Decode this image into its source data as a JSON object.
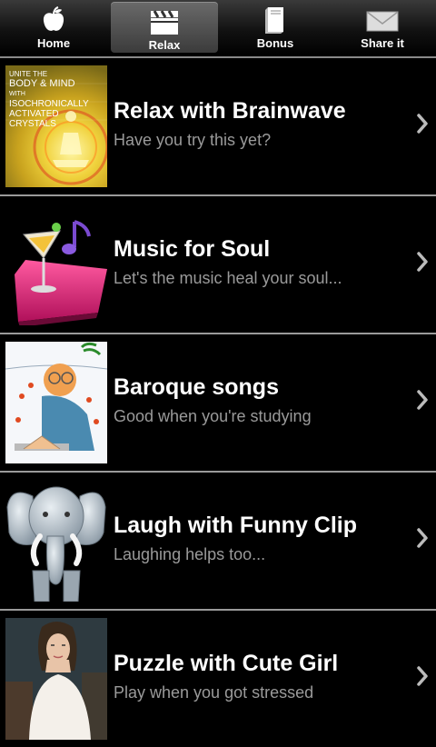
{
  "tabs": [
    {
      "label": "Home",
      "icon": "apple-icon"
    },
    {
      "label": "Relax",
      "icon": "clapperboard-icon"
    },
    {
      "label": "Bonus",
      "icon": "book-icon"
    },
    {
      "label": "Share it",
      "icon": "envelope-icon"
    }
  ],
  "active_tab": "Relax",
  "items": [
    {
      "title": "Relax with Brainwave",
      "subtitle": "Have you try this yet?",
      "thumb_text": [
        "UNITE THE",
        "BODY & MIND",
        "WITH",
        "ISOCHRONICALLY",
        "ACTIVATED",
        "CRYSTALS"
      ],
      "thumb_icon": "meditation-cover-icon"
    },
    {
      "title": "Music for Soul",
      "subtitle": "Let's the music heal your soul...",
      "thumb_icon": "music-cocktail-icon"
    },
    {
      "title": "Baroque songs",
      "subtitle": "Good when you're studying",
      "thumb_icon": "student-aquarium-illustration-icon"
    },
    {
      "title": "Laugh with Funny Clip",
      "subtitle": "Laughing helps too...",
      "thumb_icon": "elephant-icon"
    },
    {
      "title": "Puzzle with Cute Girl",
      "subtitle": "Play when you got stressed",
      "thumb_icon": "girl-photo-icon"
    }
  ],
  "colors": {
    "background": "#000000",
    "title": "#ffffff",
    "subtitle": "#9a9a9a",
    "divider": "#9a9a9a"
  }
}
